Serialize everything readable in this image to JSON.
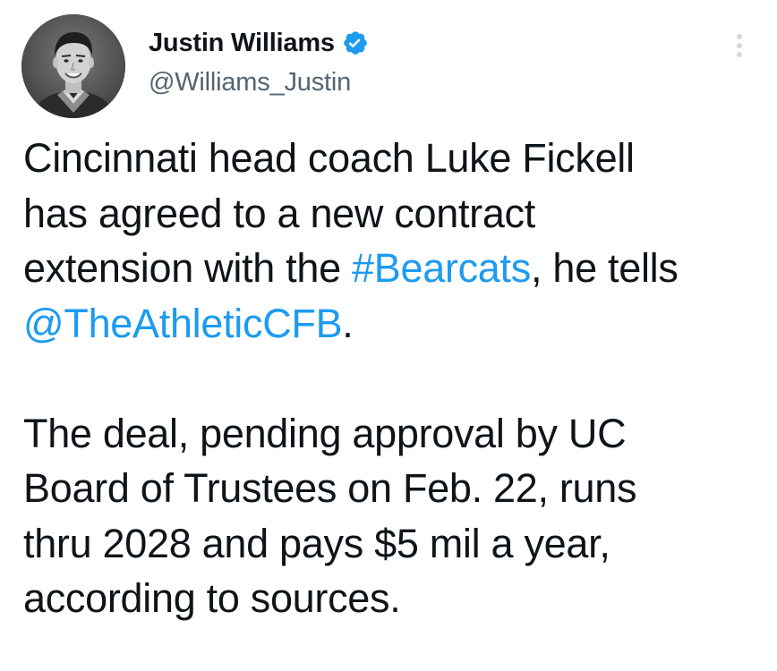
{
  "tweet": {
    "author": {
      "display_name": "Justin Williams",
      "handle": "@Williams_Justin",
      "verified": true
    },
    "body": {
      "para1": {
        "line1": "Cincinnati head coach Luke Fickell",
        "line2": "has agreed to a new contract",
        "line3_before": "extension with the ",
        "hashtag": "#Bearcats",
        "line3_after": ", he tells",
        "mention": "@TheAthleticCFB",
        "line4_after": "."
      },
      "para2": {
        "line1": "The deal, pending approval by UC",
        "line2": "Board of Trustees on Feb. 22, runs",
        "line3": "thru 2028 and pays $5 mil a year,",
        "line4": "according to sources."
      }
    },
    "icons": {
      "verified": "verified-badge-icon",
      "more": "more-options-icon"
    },
    "colors": {
      "text": "#0f1419",
      "secondary": "#536471",
      "link": "#1d9bf0",
      "background": "#ffffff"
    }
  }
}
